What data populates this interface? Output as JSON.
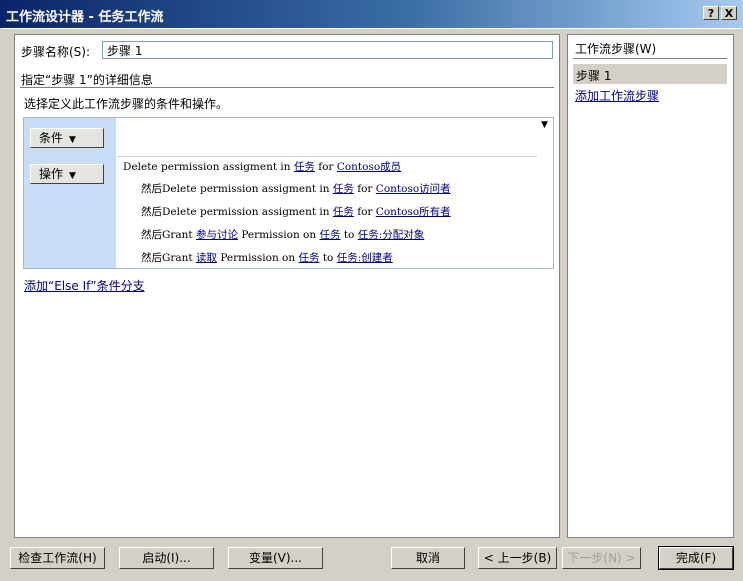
{
  "window": {
    "title": "工作流设计器 - 任务工作流",
    "help_label": "?",
    "close_label": "X"
  },
  "step_name": {
    "label": "步骤名称(S):",
    "value": "步骤 1"
  },
  "detail_heading": "指定“步骤 1”的详细信息",
  "instruction": "选择定义此工作流步骤的条件和操作。",
  "rule": {
    "conditions_button": "条件",
    "actions_button": "操作",
    "actions": [
      {
        "prefix": "",
        "text1": "Delete permission assigment in",
        "link1": "任务",
        "text2": "for",
        "link2": "Contoso成员"
      },
      {
        "prefix": "然后",
        "text1": "Delete permission assigment in",
        "link1": "任务",
        "text2": "for",
        "link2": "Contoso访问者"
      },
      {
        "prefix": "然后",
        "text1": "Delete permission assigment in",
        "link1": "任务",
        "text2": "for",
        "link2": "Contoso所有者"
      },
      {
        "prefix": "然后",
        "text1": "Grant",
        "link1": "参与讨论",
        "text2": "Permission on",
        "link2": "任务",
        "text3": "to",
        "link3": "任务:分配对象"
      },
      {
        "prefix": "然后",
        "text1": "Grant",
        "link1": "读取",
        "text2": "Permission on",
        "link2": "任务",
        "text3": "to",
        "link3": "任务:创建者"
      }
    ]
  },
  "else_if_link": "添加“Else If”条件分支",
  "steps_panel": {
    "title": "工作流步骤(W)",
    "items": [
      "步骤 1"
    ],
    "add_link": "添加工作流步骤"
  },
  "buttons": {
    "check": "检查工作流(H)",
    "start": "启动(I)...",
    "variables": "变量(V)...",
    "cancel": "取消",
    "back": "< 上一步(B)",
    "next": "下一步(N) >",
    "finish": "完成(F)"
  }
}
